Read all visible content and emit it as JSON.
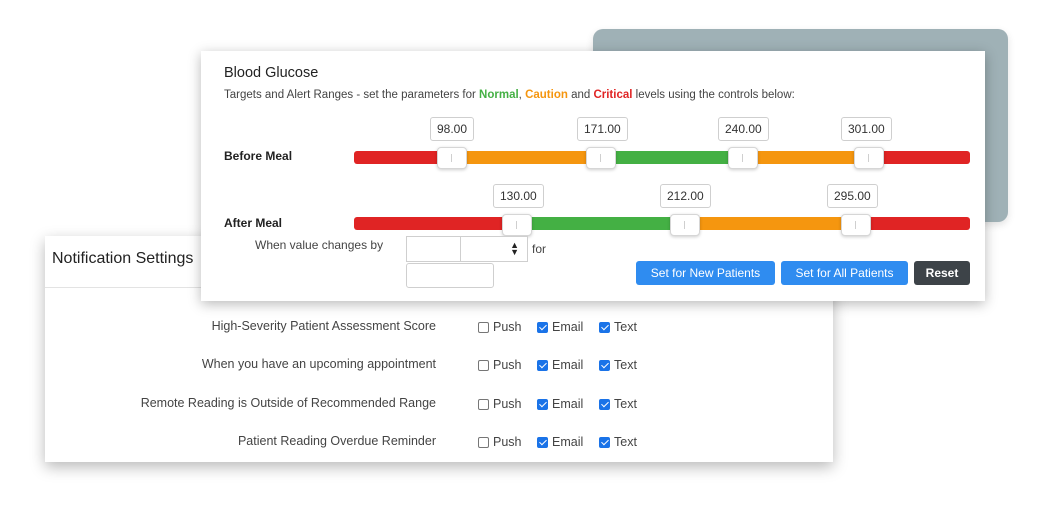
{
  "colors": {
    "normal": "#44b044",
    "caution": "#f5960f",
    "critical": "#e02424",
    "button_blue": "#2f8cf0",
    "button_dark": "#3d4348"
  },
  "notification": {
    "title": "Notification Settings",
    "rows": [
      {
        "label": "High-Severity Patient Assessment Score",
        "push": false,
        "email": true,
        "text": true
      },
      {
        "label": "When you have an upcoming appointment",
        "push": false,
        "email": true,
        "text": true
      },
      {
        "label": "Remote Reading is Outside of Recommended Range",
        "push": false,
        "email": true,
        "text": true
      },
      {
        "label": "Patient Reading Overdue Reminder",
        "push": false,
        "email": true,
        "text": true
      }
    ],
    "push_label": "Push",
    "email_label": "Email",
    "text_label": "Text"
  },
  "glucose": {
    "title": "Blood Glucose",
    "subtitle_prefix": "Targets and Alert Ranges - set the parameters for ",
    "normal_word": "Normal",
    "comma": ", ",
    "caution_word": "Caution",
    "and_word": " and ",
    "critical_word": "Critical",
    "subtitle_suffix": " levels using the controls below:",
    "before_meal": {
      "label": "Before Meal",
      "values": [
        "98.00",
        "171.00",
        "240.00",
        "301.00"
      ]
    },
    "after_meal": {
      "label": "After Meal",
      "values": [
        "130.00",
        "212.00",
        "295.00"
      ]
    },
    "change_label": "When value changes by",
    "spinner_value": "",
    "for_label": "for",
    "select_value": "",
    "buttons": {
      "new_patients": "Set for New Patients",
      "all_patients": "Set for All Patients",
      "reset": "Reset"
    }
  }
}
